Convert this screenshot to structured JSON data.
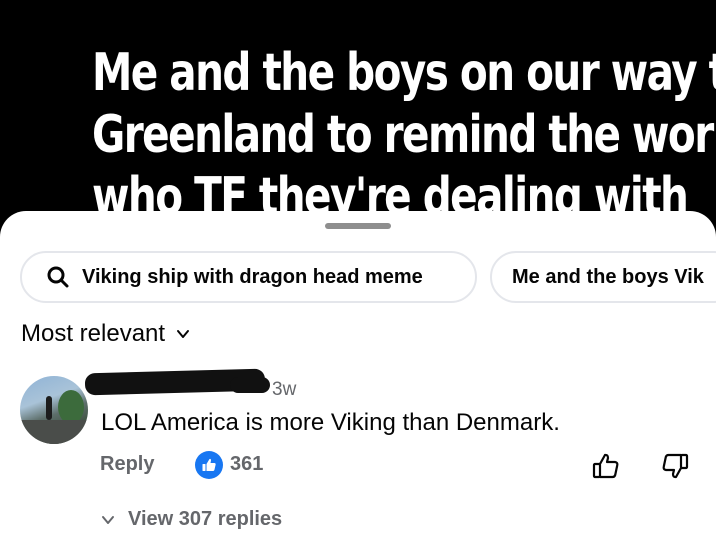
{
  "meme": {
    "lines": [
      "Me and the boys on our way to",
      "Greenland to remind the world",
      "who TF they're dealing with"
    ]
  },
  "search_chips": [
    {
      "label": "Viking ship with dragon head meme",
      "icon": "search-icon"
    },
    {
      "label": "Me and the boys Vik"
    }
  ],
  "sort": {
    "label": "Most relevant",
    "icon": "chevron-down-icon"
  },
  "comment": {
    "timestamp": "3w",
    "text": "LOL America is more Viking than Denmark.",
    "reply_label": "Reply",
    "like_count": "361",
    "view_replies_label": "View 307 replies"
  },
  "colors": {
    "like_blue": "#1877f2",
    "secondary_text": "#65676b",
    "chip_border": "#e4e6eb"
  }
}
